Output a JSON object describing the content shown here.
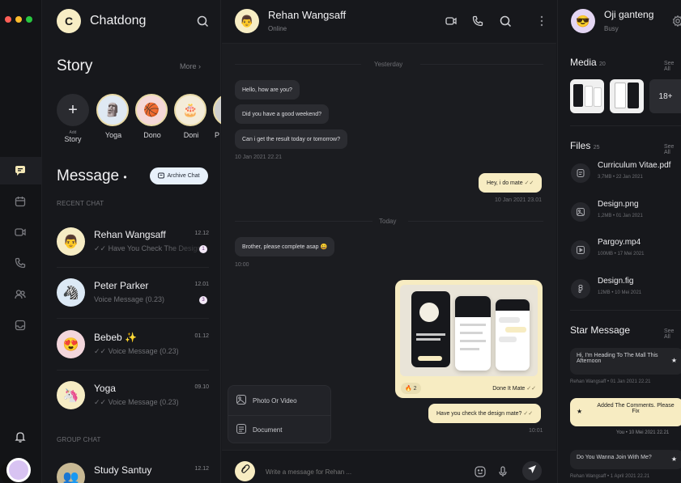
{
  "app": {
    "name": "Chatdong",
    "logo_letter": "C"
  },
  "rail": {
    "items": [
      "message-icon",
      "calendar-icon",
      "video-icon",
      "phone-icon",
      "users-icon",
      "inbox-icon",
      "bell-icon"
    ]
  },
  "story": {
    "title": "Story",
    "more_label": "More",
    "add_label": "Add",
    "add_sub": "Story",
    "items": [
      {
        "name": "Yoga",
        "emoji": "🗿"
      },
      {
        "name": "Dono",
        "emoji": "🏀"
      },
      {
        "name": "Doni",
        "emoji": "🎂"
      },
      {
        "name": "P",
        "emoji": "👤"
      }
    ]
  },
  "messages": {
    "title": "Message",
    "archive_label": "Archive Chat",
    "recent_label": "RECENT CHAT",
    "group_label": "GROUP CHAT",
    "recent": [
      {
        "name": "Rehan Wangsaff",
        "preview": "Have You Check The Design",
        "time": "12.12",
        "badge": "1",
        "emoji": "👨",
        "bg": "#f6ecc4"
      },
      {
        "name": "Peter Parker",
        "preview": "Voice Message (0.23)",
        "time": "12.01",
        "badge": "3",
        "emoji": "🦓",
        "bg": "#dce9f5"
      },
      {
        "name": "Bebeb ✨",
        "preview": "Voice Message (0.23)",
        "time": "01.12",
        "badge": "",
        "emoji": "😍",
        "bg": "#f3d6dc"
      },
      {
        "name": "Yoga",
        "preview": "Voice Message (0.23)",
        "time": "09.10",
        "badge": "",
        "emoji": "🦄",
        "bg": "#f6ecc4"
      }
    ],
    "group": [
      {
        "name": "Study Santuy",
        "time": "12.12",
        "emoji": "👥",
        "bg": "#c8b994"
      }
    ]
  },
  "conversation": {
    "contact_name": "Rehan Wangsaff",
    "contact_status": "Online",
    "day_yesterday": "Yesterday",
    "day_today": "Today",
    "incoming_1": [
      "Hello, how are you?",
      "Did you have a good weekend?",
      "Can i get the result today or tomorrow?"
    ],
    "incoming_1_time": "10 Jan 2021 22.21",
    "outgoing_1": "Hey, i do mate",
    "outgoing_1_time": "10 Jan 2021 23.01",
    "incoming_2": "Brother, please complete asap 😀",
    "incoming_2_time": "10:00",
    "image_reaction": "🔥 2",
    "image_caption": "Done It Mate",
    "outgoing_2": "Have you check the design mate?",
    "outgoing_2_time": "10:01",
    "attach_menu": [
      "Photo Or Video",
      "Document"
    ],
    "input_placeholder": "Write a message for Rehan ..."
  },
  "profile": {
    "name": "Oji ganteng",
    "status": "Busy",
    "emoji": "😎"
  },
  "media": {
    "title": "Media",
    "count": "20",
    "see_all": "See All",
    "more_count": "18+"
  },
  "files": {
    "title": "Files",
    "count": "25",
    "see_all": "See All",
    "items": [
      {
        "name": "Curriculum Vitae.pdf",
        "meta": "3,7MB  •  22 Jan 2021",
        "icon": "document-icon"
      },
      {
        "name": "Design.png",
        "meta": "1,2MB  •  01 Jan 2021",
        "icon": "image-icon"
      },
      {
        "name": "Pargoy.mp4",
        "meta": "100MB  •  17 Mei 2021",
        "icon": "video-file-icon"
      },
      {
        "name": "Design.fig",
        "meta": "12MB  •  10 Mei 2021",
        "icon": "figma-icon"
      }
    ]
  },
  "star_message": {
    "title": "Star Message",
    "see_all": "See All",
    "items": [
      {
        "text": "Hi, I'm Heading To The Mall This Afternoon",
        "meta": "Rehan Wangsaff  •  01 Jan 2021  22.21"
      },
      {
        "text": "Added The Comments. Please Fix",
        "meta": "You  •  10 Mei 2021  22.21"
      },
      {
        "text": "Do You Wanna Join With Me?",
        "meta": "Rehan Wangsaff  •  1 April 2021  22.21"
      }
    ]
  },
  "colors": {
    "accent": "#f7ecc2",
    "bg": "#17181c",
    "bubble_in": "#2b2c31"
  }
}
